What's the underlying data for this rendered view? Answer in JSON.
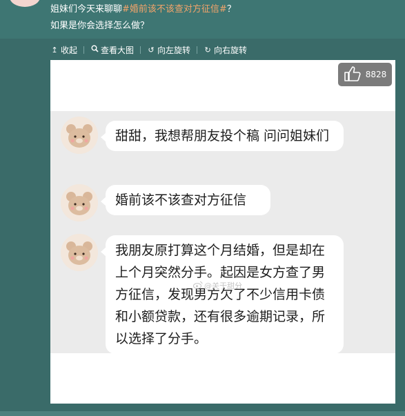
{
  "post": {
    "line1_text": "姐妹们今天来聊聊",
    "hashtag": "#婚前该不该查对方征信#",
    "line1_suffix": "？",
    "line2": "如果是你会选择怎么做？"
  },
  "toolbar": {
    "collapse": "收起",
    "view_large": "查看大图",
    "rotate_left": "向左旋转",
    "rotate_right": "向右旋转"
  },
  "image": {
    "like_count": "8828",
    "watermark": "@关于甜分",
    "messages": [
      {
        "text": "甜甜，我想帮朋友投个稿 问问姐妹们"
      },
      {
        "text": "婚前该不该查对方征信"
      },
      {
        "text": "我朋友原打算这个月结婚，但是却在上个月突然分手。起因是女方查了男方征信，发现男方欠了不少信用卡债和小额贷款，还有很多逾期记录，所以选择了分手。"
      }
    ]
  },
  "colors": {
    "background": "#3a6b69",
    "header": "#3e7673",
    "hashtag": "#f3a46a",
    "chat_bg": "#ebebeb",
    "bubble": "#ffffff"
  }
}
